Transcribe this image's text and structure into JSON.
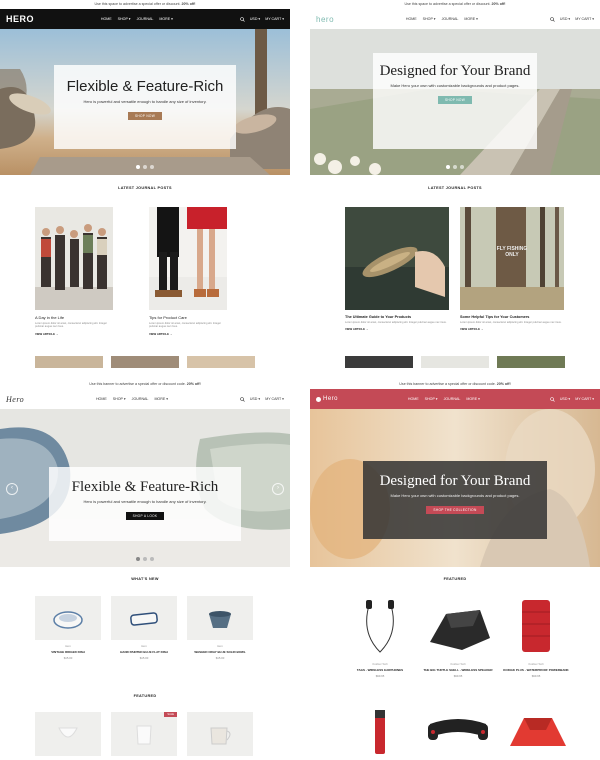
{
  "panels": {
    "p1": {
      "promo": "Use this space to advertise a special offer or discount.",
      "promo_bold": "20% off!",
      "logo": "HERO",
      "menu": [
        "HOME",
        "SHOP ▾",
        "JOURNAL",
        "MORE ▾"
      ],
      "account": "USD ▾",
      "cart": "MY CART ▾",
      "hero_title": "Flexible & Feature-Rich",
      "hero_sub": "Hero is powerful and versatile enough to handle any size of inventory.",
      "hero_btn": "SHOP NOW",
      "section": "LATEST JOURNAL POSTS",
      "posts": [
        {
          "title": "A Day in the Life",
          "excerpt": "Lorem ipsum dolor sit amet, consectetur adipiscing elit. Integer pulvinar augue nec risus.",
          "more": "VIEW ARTICLE →"
        },
        {
          "title": "Tips for Product Care",
          "excerpt": "Lorem ipsum dolor sit amet, consectetur adipiscing elit. Integer pulvinar augue nec risus.",
          "more": "VIEW ARTICLE →"
        }
      ]
    },
    "p2": {
      "promo": "Use this space to advertise a special offer or discount.",
      "promo_bold": "20% off!",
      "logo": "hero",
      "menu": [
        "HOME",
        "SHOP ▾",
        "JOURNAL",
        "MORE ▾"
      ],
      "account": "USD ▾",
      "cart": "MY CART ▾",
      "hero_title": "Designed for Your Brand",
      "hero_sub": "Make Hero your own with customizable backgrounds and product pages.",
      "hero_btn": "SHOP NOW",
      "section": "LATEST JOURNAL POSTS",
      "posts": [
        {
          "title": "The Ultimate Guide to Your Products",
          "excerpt": "Lorem ipsum dolor sit amet, consectetur adipiscing elit. Integer pulvinar augue nec risus.",
          "more": "VIEW ARTICLE →"
        },
        {
          "title": "Some Helpful Tips for Your Customers",
          "excerpt": "Lorem ipsum dolor sit amet, consectetur adipiscing elit. Integer pulvinar augue nec risus.",
          "more": "VIEW ARTICLE →"
        }
      ],
      "sign": "FLY FISHING ONLY"
    },
    "p3": {
      "promo": "Use this banner to advertise a special offer or discount code.",
      "promo_bold": "20% off!",
      "logo": "Hero",
      "menu": [
        "HOME",
        "SHOP ▾",
        "JOURNAL",
        "MORE ▾"
      ],
      "account": "USD ▾",
      "cart": "MY CART ▾",
      "hero_title": "Flexible & Feature-Rich",
      "hero_sub": "Hero is powerful and versatile enough to handle any size of inventory.",
      "hero_btn": "SHOP A LOOK",
      "section": "WHAT'S NEW",
      "section2": "FEATURED",
      "products": [
        {
          "vendor": "Hero",
          "name": "VINTAGE RIDGED DISH",
          "price": "$15.00"
        },
        {
          "vendor": "Hero",
          "name": "HAND PAINTED BLUE FLAT DISH",
          "price": "$15.00"
        },
        {
          "vendor": "Hero",
          "name": "WASHED ORAY BLUE SOLID BOWL",
          "price": "$15.00"
        }
      ],
      "sale_badge": "SALE"
    },
    "p4": {
      "promo": "Use this banner to advertise a special offer or discount code.",
      "promo_bold": "20% off!",
      "logo": "Hero",
      "menu": [
        "HOME",
        "SHOP ▾",
        "JOURNAL",
        "MORE ▾"
      ],
      "account": "USD ▾",
      "cart": "MY CART ▾",
      "hero_title": "Designed for Your Brand",
      "hero_sub": "Make Hero your own with customizable backgrounds and product pages.",
      "hero_btn": "SHOP THE COLLECTION",
      "section": "FEATURED",
      "products": [
        {
          "vendor": "Outdoor Tech",
          "name": "TAGS - WIRELESS EARPHONES",
          "price": "$99.95"
        },
        {
          "vendor": "Outdoor Tech",
          "name": "THE BIG TURTLE SHELL - WIRELESS SPEAKER",
          "price": "$99.95"
        },
        {
          "vendor": "Outdoor Tech",
          "name": "KODIAK PLUS - WATERPROOF POWERBANK",
          "price": "$99.95"
        }
      ]
    }
  },
  "colors": {
    "p1_nav": "#111111",
    "p4_accent": "#c44a56",
    "p1_btn": "#a87a55",
    "p2_btn": "#7fbab0"
  }
}
